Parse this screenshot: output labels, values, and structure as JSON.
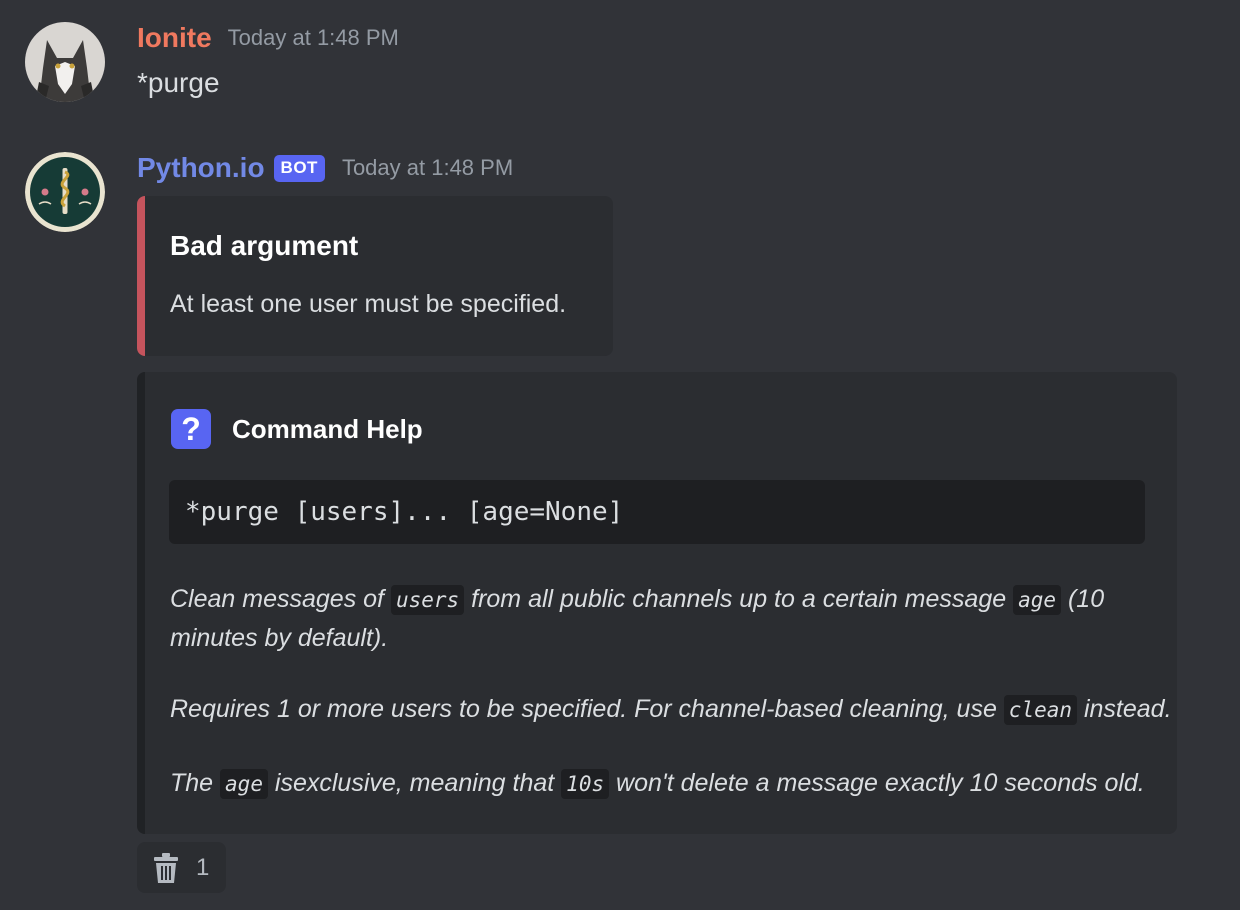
{
  "messages": [
    {
      "username": "Ionite",
      "timestamp": "Today at 1:48 PM",
      "text": "*purge"
    },
    {
      "username": "Python.io",
      "bot_tag": "BOT",
      "timestamp": "Today at 1:48 PM"
    }
  ],
  "error_embed": {
    "title": "Bad argument",
    "description": "At least one user must be specified.",
    "color": "#c5545d"
  },
  "help_embed": {
    "author": "Command Help",
    "author_icon": "question-icon",
    "usage": "*purge [users]... [age=None]",
    "para1": {
      "t1": "Clean messages of ",
      "c1": "users",
      "t2": " from all public channels up to a certain message ",
      "c2": "age",
      "t3": " (10",
      "line2": "minutes by default)."
    },
    "para2": {
      "t1": "Requires 1 or more users to be specified. For channel-based cleaning, use ",
      "c1": "clean",
      "t2": " instead."
    },
    "para3": {
      "t1": "The ",
      "c1": "age",
      "t2": " isexclusive, meaning that ",
      "c2": "10s",
      "t3": " won't delete a message exactly 10 seconds old."
    }
  },
  "reaction": {
    "icon": "trash-icon",
    "count": "1"
  }
}
